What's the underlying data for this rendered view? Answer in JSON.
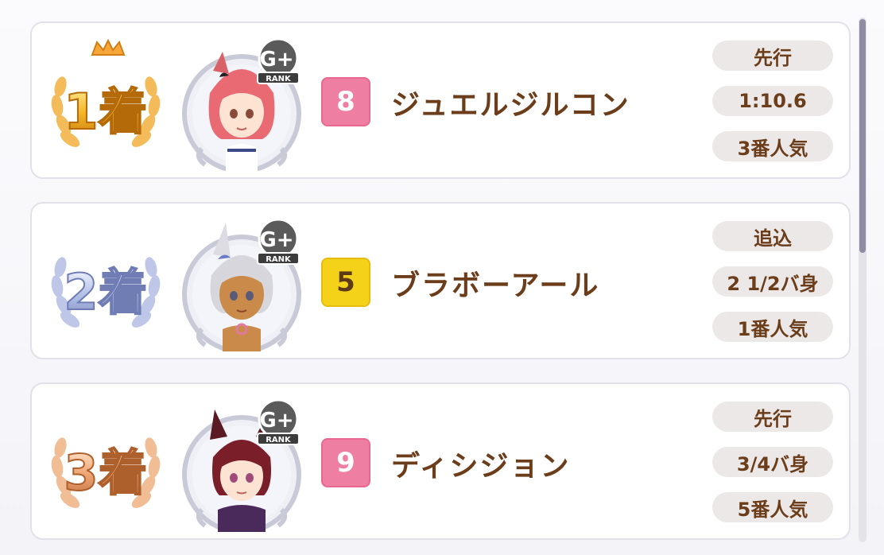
{
  "results": [
    {
      "place": "1着",
      "rank": "RANK",
      "grade": "G+",
      "gate": "8",
      "gate_color": "#ef7fa2",
      "name": "ジュエルジルコン",
      "strategy": "先行",
      "margin": "1:10.6",
      "popularity": "3番人気",
      "hair_color": "#e96a73",
      "place_theme": "gold"
    },
    {
      "place": "2着",
      "rank": "RANK",
      "grade": "G+",
      "gate": "5",
      "gate_color": "#f5d21a",
      "name": "ブラボーアール",
      "strategy": "追込",
      "margin": "2 1/2バ身",
      "popularity": "1番人気",
      "hair_color": "#d6d6dc",
      "place_theme": "silver"
    },
    {
      "place": "3着",
      "rank": "RANK",
      "grade": "G+",
      "gate": "9",
      "gate_color": "#ef7fa2",
      "name": "ディシジョン",
      "strategy": "先行",
      "margin": "3/4バ身",
      "popularity": "5番人気",
      "hair_color": "#7a1e2a",
      "place_theme": "bronze"
    }
  ]
}
